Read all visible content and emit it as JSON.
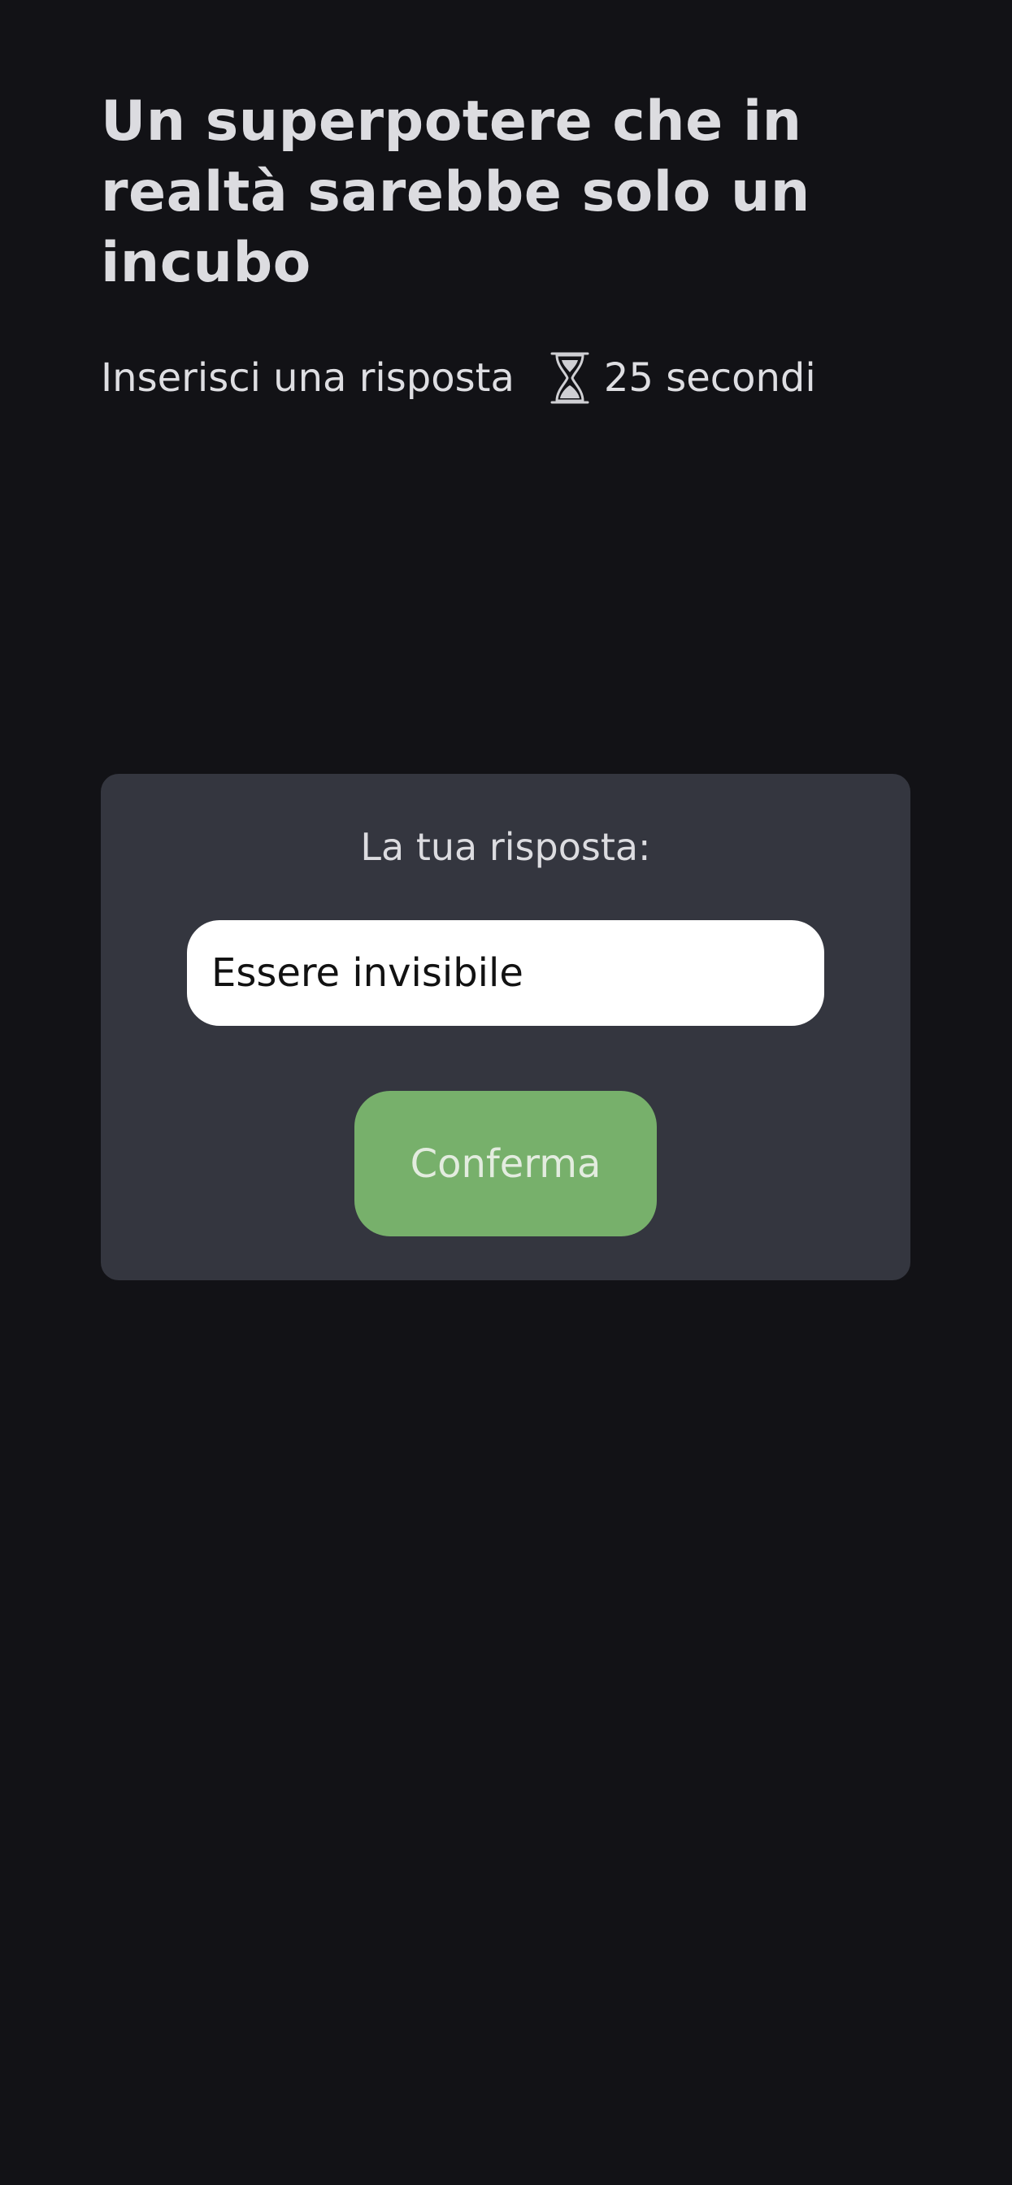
{
  "question": {
    "title": "Un superpotere che in realtà sarebbe solo un incubo"
  },
  "meta": {
    "instruction": "Inserisci una risposta",
    "timer_icon": "hourglass-icon",
    "timer_text": "25 secondi"
  },
  "answer_card": {
    "label": "La tua risposta:",
    "input_value": "Essere invisibile",
    "confirm_label": "Conferma"
  },
  "colors": {
    "background": "#121216",
    "card": "#34363f",
    "confirm_button": "#77b06b",
    "input_background": "#ffffff"
  }
}
